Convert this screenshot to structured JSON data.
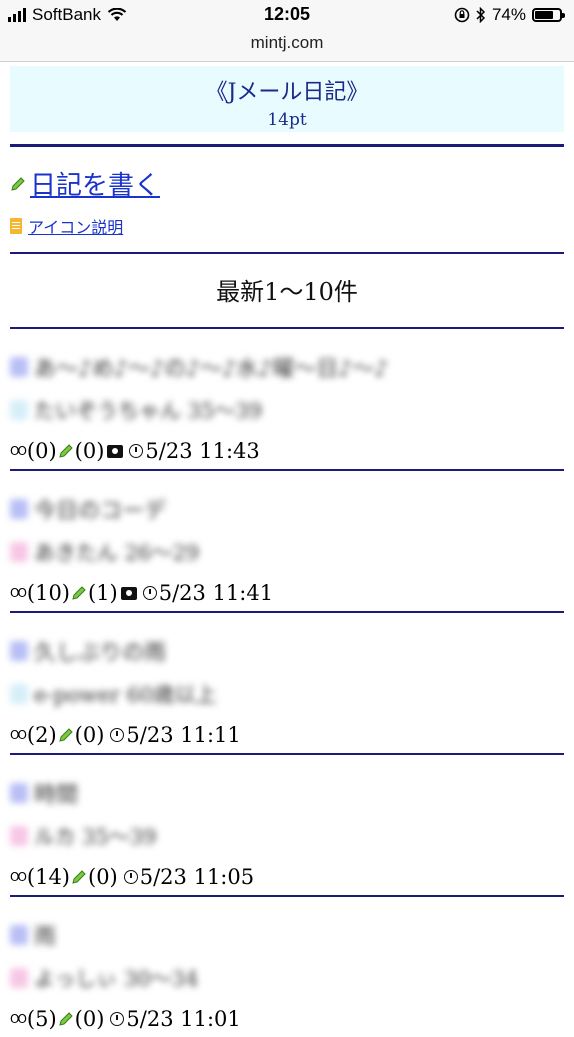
{
  "status_bar": {
    "carrier": "SoftBank",
    "time": "12:05",
    "battery": "74%",
    "battery_level": 0.74
  },
  "url": "mintj.com",
  "header": {
    "title": "《Jメール日記》",
    "subtitle": "14pt"
  },
  "links": {
    "write_diary": "日記を書く",
    "icon_help": "アイコン説明"
  },
  "section_title": "最新1〜10件",
  "entries": [
    {
      "title": "あ〜♪め♪〜♪の♪〜♪水♪曜〜日♪〜♪",
      "author": "たいぞうちゃん 35〜39",
      "views": "(0)",
      "comments": "(0)",
      "has_photo": true,
      "date": "5/23 11:43",
      "title_icon_color": "#b8bff5",
      "author_icon_color": "#d6eef8"
    },
    {
      "title": "今日のコーデ",
      "author": "あきたん 26〜29",
      "views": "(10)",
      "comments": "(1)",
      "has_photo": true,
      "date": "5/23 11:41",
      "title_icon_color": "#b8bff5",
      "author_icon_color": "#f7c7e6"
    },
    {
      "title": "久しぶりの雨",
      "author": "e-power 60歳以上",
      "views": "(2)",
      "comments": "(0)",
      "has_photo": false,
      "date": "5/23 11:11",
      "title_icon_color": "#b8bff5",
      "author_icon_color": "#d6eef8"
    },
    {
      "title": "時間",
      "author": "ルカ 35〜39",
      "views": "(14)",
      "comments": "(0)",
      "has_photo": false,
      "date": "5/23 11:05",
      "title_icon_color": "#b8bff5",
      "author_icon_color": "#f7c7e6"
    },
    {
      "title": "雨",
      "author": "よっしぃ 30〜34",
      "views": "(5)",
      "comments": "(0)",
      "has_photo": false,
      "date": "5/23 11:01",
      "title_icon_color": "#b8bff5",
      "author_icon_color": "#f7c7e6"
    }
  ]
}
